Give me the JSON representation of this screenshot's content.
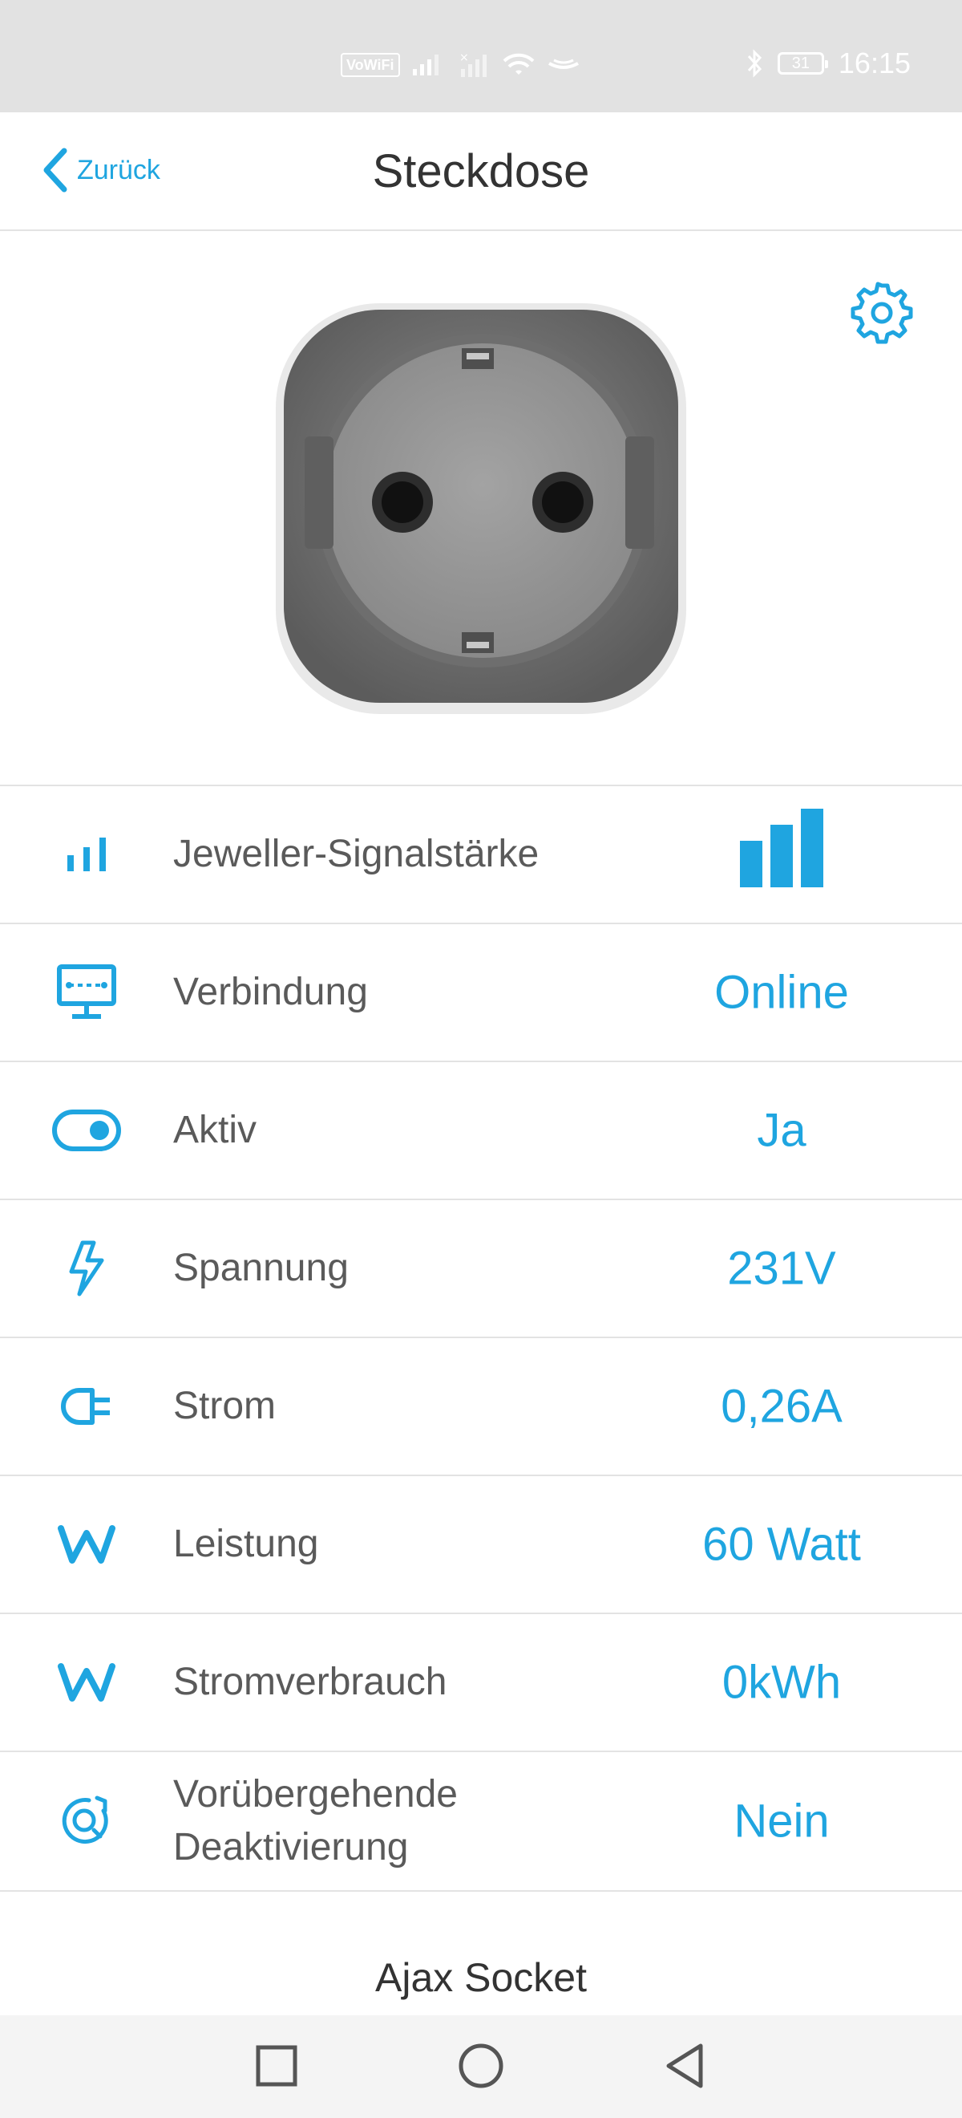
{
  "status_bar": {
    "volte": "VoWiFi",
    "battery": "31",
    "time": "16:15"
  },
  "header": {
    "back_label": "Zurück",
    "title": "Steckdose"
  },
  "rows": [
    {
      "label": "Jeweller-Signalstärke",
      "icon": "signal-bars-icon",
      "value_type": "signal",
      "signal_level": 3,
      "signal_max": 3
    },
    {
      "label": "Verbindung",
      "icon": "monitor-connection-icon",
      "value": "Online"
    },
    {
      "label": "Aktiv",
      "icon": "toggle-icon",
      "value": "Ja"
    },
    {
      "label": "Spannung",
      "icon": "lightning-icon",
      "value": "231V"
    },
    {
      "label": "Strom",
      "icon": "plug-icon",
      "value": "0,26A"
    },
    {
      "label": "Leistung",
      "icon": "watt-icon",
      "value": "60 Watt"
    },
    {
      "label": "Stromverbrauch",
      "icon": "watt-icon",
      "value": "0kWh"
    },
    {
      "label_line1": "Vorübergehende",
      "label_line2": "Deaktivierung",
      "icon": "temporary-deactivation-icon",
      "value": "Nein"
    }
  ],
  "footer": {
    "device_name": "Ajax Socket"
  },
  "colors": {
    "accent": "#1fa5e0",
    "text": "#5a5a5a",
    "status_bar_bg": "#e2e2e2"
  }
}
